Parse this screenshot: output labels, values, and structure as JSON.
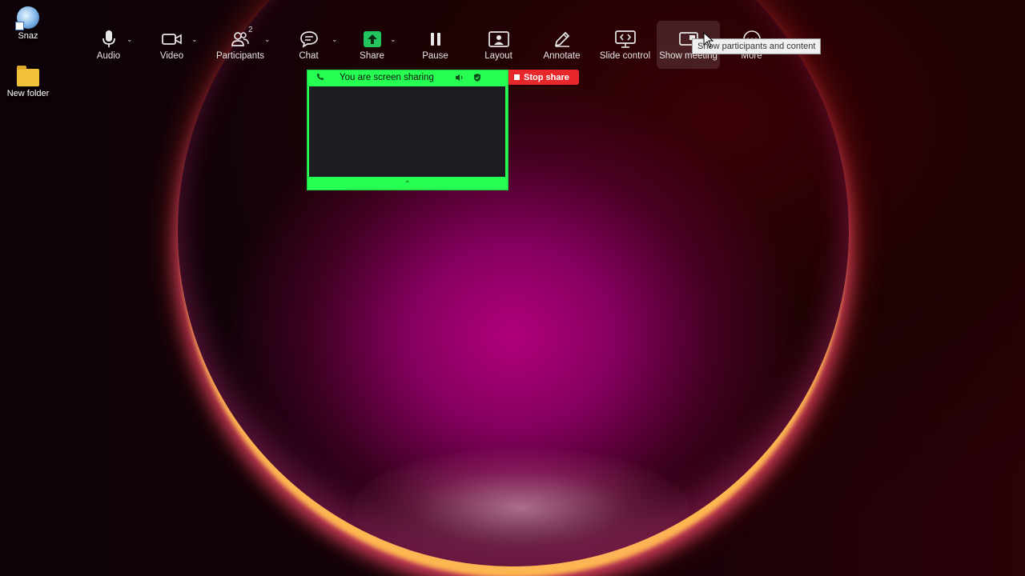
{
  "desktop": {
    "icons": [
      {
        "label": "Snaz"
      },
      {
        "label": "New folder"
      }
    ]
  },
  "toolbar": {
    "audio": {
      "label": "Audio",
      "icon": "microphone-icon"
    },
    "video": {
      "label": "Video",
      "icon": "camera-icon"
    },
    "participants": {
      "label": "Participants",
      "count": "2",
      "icon": "participants-icon"
    },
    "chat": {
      "label": "Chat",
      "icon": "chat-icon"
    },
    "share": {
      "label": "Share",
      "icon": "share-arrow-icon",
      "accent": "#22c55e"
    },
    "pause": {
      "label": "Pause",
      "icon": "pause-icon"
    },
    "layout": {
      "label": "Layout",
      "icon": "layout-icon"
    },
    "annotate": {
      "label": "Annotate",
      "icon": "pencil-icon"
    },
    "slide_control": {
      "label": "Slide control",
      "icon": "slide-control-icon"
    },
    "show_meeting": {
      "label": "Show meeting",
      "icon": "show-meeting-icon"
    },
    "more": {
      "label": "More",
      "icon": "more-icon"
    }
  },
  "tooltip": {
    "text": "Show participants and content"
  },
  "share_window": {
    "status": "You are screen sharing",
    "accent": "#26ff52"
  },
  "stop_share": {
    "label": "Stop share",
    "color": "#e8272b"
  }
}
